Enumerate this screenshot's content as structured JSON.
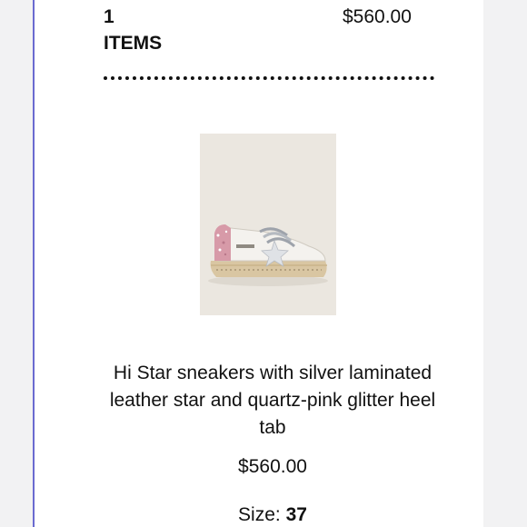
{
  "summary": {
    "item_count": "1",
    "item_count_label": "ITEMS",
    "total": "$560.00"
  },
  "product": {
    "image_alt": "Hi Star sneaker",
    "title": "Hi Star sneakers with silver laminated leather star and quartz-pink glitter heel tab",
    "price": "$560.00",
    "size_label": "Size:",
    "size_value": "37"
  },
  "colors": {
    "panel_background": "#ffffff",
    "page_background": "#f2f2f3",
    "left_rule": "#6a6ad0",
    "text": "#111111",
    "image_background": "#eae6df",
    "glitter_pink": "#d79aa8",
    "star_silver": "#d8dbe0"
  }
}
